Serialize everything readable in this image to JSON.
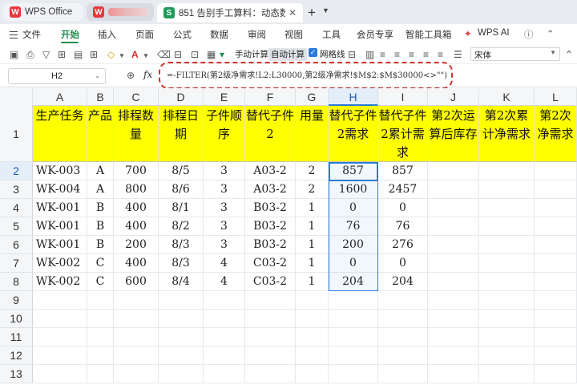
{
  "tabs": [
    {
      "label": "WPS Office"
    },
    {
      "label": ""
    },
    {
      "label": "851 告别手工算料：动态数组打造"
    }
  ],
  "menu": {
    "file": "文件",
    "items": [
      "开始",
      "插入",
      "页面",
      "公式",
      "数据",
      "审阅",
      "视图",
      "工具",
      "会员专享",
      "智能工具箱"
    ],
    "wps_ai": "WPS AI"
  },
  "toolbar": {
    "manual_calc": "手动计算",
    "auto_calc": "自动计算",
    "gridlines": "网格线",
    "font": "宋体"
  },
  "formula_bar": {
    "name_box": "H2",
    "fx": "fx",
    "formula": "=-FILTER(第2级净需求!L2:L30000,第2级净需求!$M$2:$M$30000<>\"\")"
  },
  "columns": [
    "A",
    "B",
    "C",
    "D",
    "E",
    "F",
    "G",
    "H",
    "I",
    "J",
    "K",
    "L"
  ],
  "selected_column": "H",
  "rows": [
    "1",
    "2",
    "3",
    "4",
    "5",
    "6",
    "7",
    "8",
    "9",
    "10",
    "11",
    "12",
    "13"
  ],
  "selected_row": "2",
  "headers": [
    "生产任务",
    "产品",
    "排程数量",
    "排程日期",
    "子件顺序",
    "替代子件2",
    "用量",
    "替代子件2需求",
    "替代子件2累计需求",
    "第2次运算后库存",
    "第2次累计净需求",
    "第2次净需求"
  ],
  "data": [
    [
      "WK-003",
      "A",
      "700",
      "8/5",
      "3",
      "A03-2",
      "2",
      "857",
      "857"
    ],
    [
      "WK-004",
      "A",
      "800",
      "8/6",
      "3",
      "A03-2",
      "2",
      "1600",
      "2457"
    ],
    [
      "WK-001",
      "B",
      "400",
      "8/1",
      "3",
      "B03-2",
      "1",
      "0",
      "0"
    ],
    [
      "WK-001",
      "B",
      "400",
      "8/2",
      "3",
      "B03-2",
      "1",
      "76",
      "76"
    ],
    [
      "WK-001",
      "B",
      "200",
      "8/3",
      "3",
      "B03-2",
      "1",
      "200",
      "276"
    ],
    [
      "WK-002",
      "C",
      "400",
      "8/3",
      "4",
      "C03-2",
      "1",
      "0",
      "0"
    ],
    [
      "WK-002",
      "C",
      "600",
      "8/4",
      "4",
      "C03-2",
      "1",
      "204",
      "204"
    ]
  ]
}
